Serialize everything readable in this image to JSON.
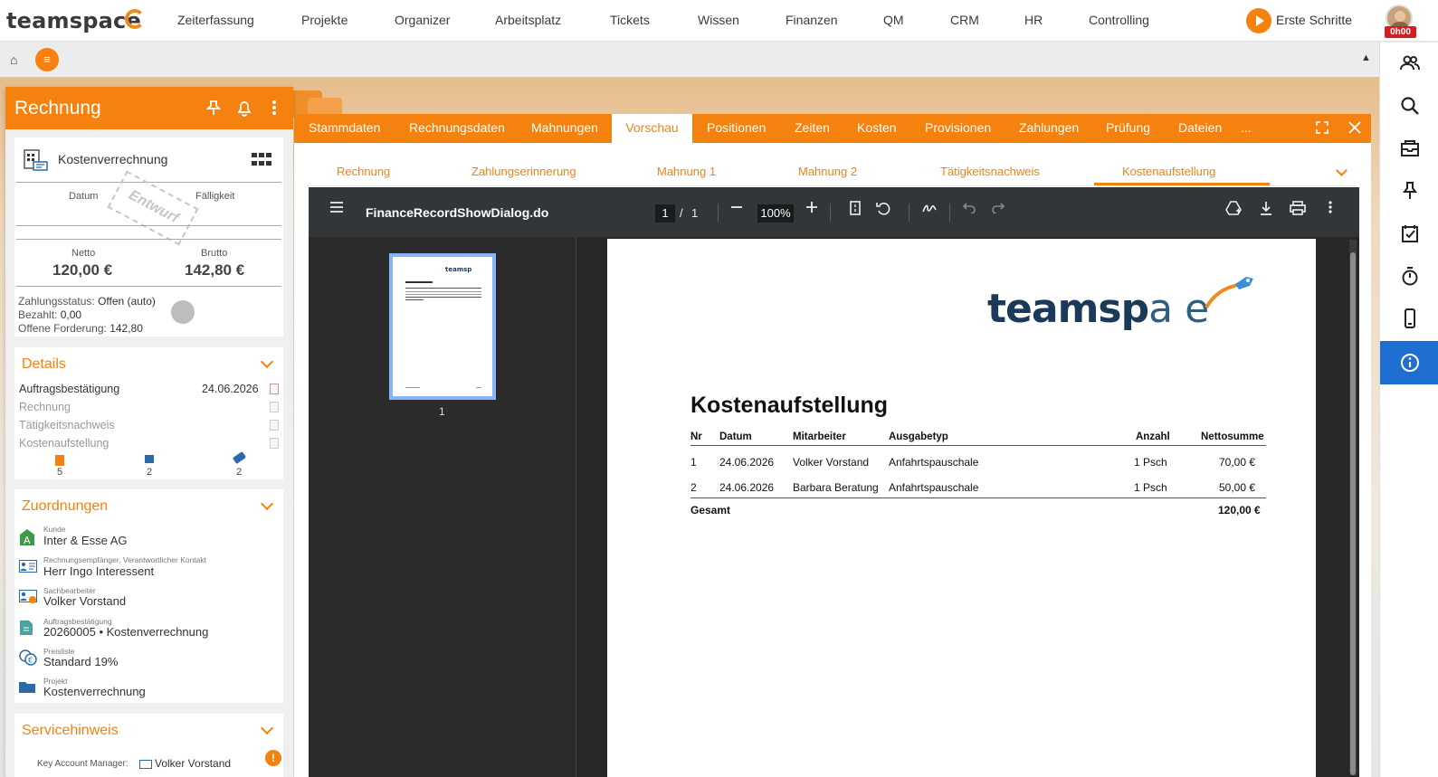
{
  "app": {
    "logo": "teamspace",
    "menu": [
      "Zeiterfassung",
      "Projekte",
      "Organizer",
      "Arbeitsplatz",
      "Tickets",
      "Wissen",
      "Finanzen",
      "QM",
      "CRM",
      "HR",
      "Controlling"
    ],
    "start_label": "Erste Schritte",
    "timer": "0h00",
    "accent_color": "#f5820f",
    "active_sidebar_color": "#1e6fd0"
  },
  "left": {
    "title": "Rechnung",
    "kv_title": "Kostenverrechnung",
    "datum_label": "Datum",
    "faelligkeit_label": "Fälligkeit",
    "stamp": "Entwurf",
    "netto_label": "Netto",
    "netto_value": "120,00 €",
    "brutto_label": "Brutto",
    "brutto_value": "142,80 €",
    "zahlungsstatus_label": "Zahlungsstatus:",
    "zahlungsstatus_value": "Offen (auto)",
    "bezahlt_label": "Bezahlt:",
    "bezahlt_value": "0,00",
    "offen_label": "Offene Forderung:",
    "offen_value": "142,80",
    "details": {
      "title": "Details",
      "rows": [
        {
          "label": "Auftragsbestätigung",
          "date": "24.06.2026"
        },
        {
          "label": "Rechnung",
          "date": ""
        },
        {
          "label": "Tätigkeitsnachweis",
          "date": ""
        },
        {
          "label": "Kostenaufstellung",
          "date": ""
        }
      ],
      "counts": [
        "5",
        "2",
        "2"
      ]
    },
    "zuordnungen": {
      "title": "Zuordnungen",
      "items": [
        {
          "small": "Kunde",
          "value": "Inter & Esse AG",
          "icon": "customer-icon"
        },
        {
          "small": "Rechnungsempfänger, Verantwortlicher Kontakt",
          "value": "Herr Ingo Interessent",
          "icon": "contact-card-icon"
        },
        {
          "small": "Sachbearbeiter",
          "value": "Volker Vorstand",
          "icon": "employee-icon"
        },
        {
          "small": "Auftragsbestätigung",
          "value": "20260005 • Kostenverrechnung",
          "icon": "document-icon"
        },
        {
          "small": "Preisliste",
          "value": "Standard 19%",
          "icon": "coins-icon"
        },
        {
          "small": "Projekt",
          "value": "Kostenverrechnung",
          "icon": "folder-icon"
        }
      ]
    },
    "servicehinweis": {
      "title": "Servicehinweis",
      "kam_label": "Key Account Manager:",
      "kam_value": "Volker Vorstand"
    }
  },
  "dialog": {
    "tabs": [
      "Stammdaten",
      "Rechnungsdaten",
      "Mahnungen",
      "Vorschau",
      "Positionen",
      "Zeiten",
      "Kosten",
      "Provisionen",
      "Zahlungen",
      "Prüfung",
      "Dateien",
      "..."
    ],
    "active_tab": "Vorschau",
    "subtabs": [
      "Rechnung",
      "Zahlungserinnerung",
      "Mahnung 1",
      "Mahnung 2",
      "Tätigkeitsnachweis",
      "Kostenaufstellung"
    ],
    "active_subtab": "Kostenaufstellung"
  },
  "pdf": {
    "filename": "FinanceRecordShowDialog.do",
    "page_current": "1",
    "page_sep": "/",
    "page_total": "1",
    "zoom": "100%",
    "thumb_label": "1",
    "doc": {
      "logo_bold": "teamsp",
      "logo_thin": "a",
      "logo_end": "e",
      "title": "Kostenaufstellung",
      "headers": [
        "Nr",
        "Datum",
        "Mitarbeiter",
        "Ausgabetyp",
        "Anzahl",
        "Nettosumme"
      ],
      "rows": [
        [
          "1",
          "24.06.2026",
          "Volker Vorstand",
          "Anfahrtspauschale",
          "1 Psch",
          "70,00 €"
        ],
        [
          "2",
          "24.06.2026",
          "Barbara Beratung",
          "Anfahrtspauschale",
          "1 Psch",
          "50,00 €"
        ]
      ],
      "total_label": "Gesamt",
      "total_value": "120,00 €"
    }
  }
}
